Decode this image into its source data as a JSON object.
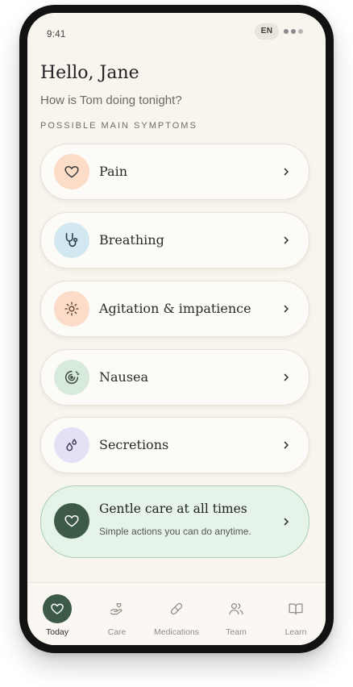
{
  "status": {
    "time": "9:41",
    "language": "EN"
  },
  "header": {
    "greeting": "Hello, Jane",
    "subtitle": "How is Tom doing tonight?",
    "section_label": "POSSIBLE MAIN SYMPTOMS"
  },
  "symptoms": [
    {
      "label": "Pain",
      "icon": "heart-icon",
      "color": "#fbdcc6"
    },
    {
      "label": "Breathing",
      "icon": "stethoscope-icon",
      "color": "#d2e8f0"
    },
    {
      "label": "Agitation & impatience",
      "icon": "sun-icon",
      "color": "#fcdcc8"
    },
    {
      "label": "Nausea",
      "icon": "swirl-icon",
      "color": "#d8eadc"
    },
    {
      "label": "Secretions",
      "icon": "droplets-icon",
      "color": "#e4e0f6"
    }
  ],
  "care": {
    "title": "Gentle care at all times",
    "subtitle": "Simple actions you can do anytime.",
    "icon": "heart-icon",
    "color": "#3d5a48"
  },
  "tabs": [
    {
      "label": "Today",
      "icon": "heart-icon",
      "active": true
    },
    {
      "label": "Care",
      "icon": "hand-heart-icon",
      "active": false
    },
    {
      "label": "Medications",
      "icon": "pill-icon",
      "active": false
    },
    {
      "label": "Team",
      "icon": "users-icon",
      "active": false
    },
    {
      "label": "Learn",
      "icon": "book-icon",
      "active": false
    }
  ],
  "colors": {
    "accent": "#3d5a48",
    "background": "#f8f4ee",
    "card": "#fdfbf7",
    "care_card": "#e5f3e8"
  }
}
